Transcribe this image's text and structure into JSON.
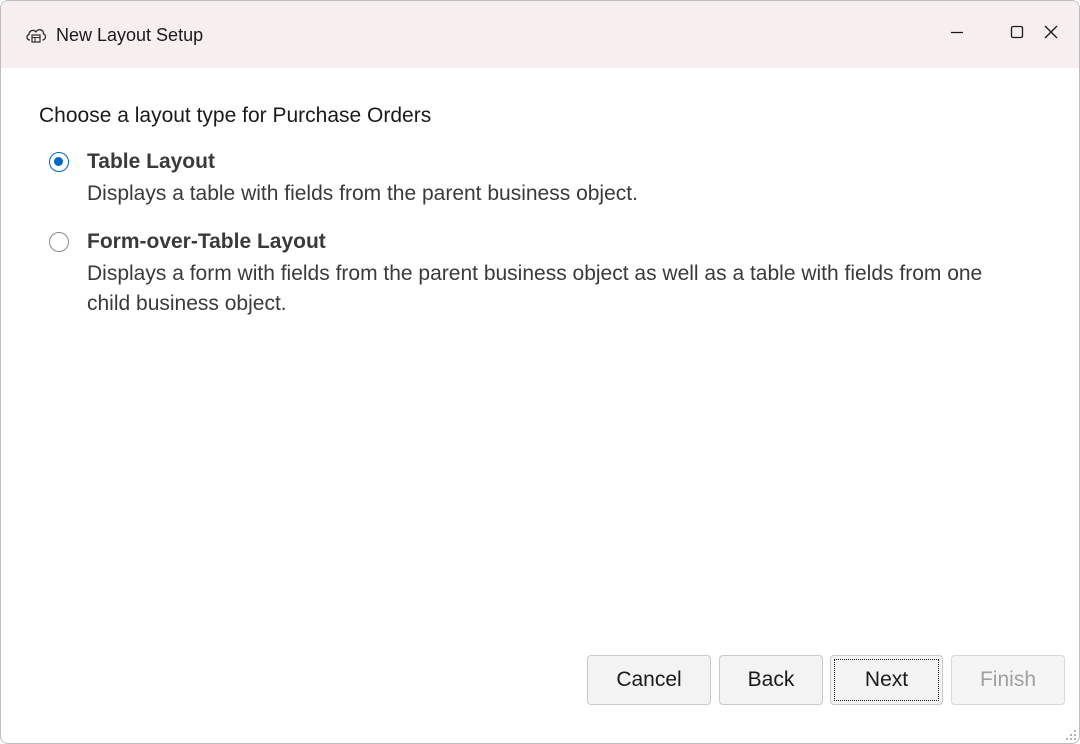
{
  "window": {
    "title": "New Layout Setup",
    "icon": "cloud-layout-icon",
    "controls": {
      "minimize_icon": "minimize-icon",
      "maximize_icon": "maximize-icon",
      "close_icon": "close-icon"
    }
  },
  "main": {
    "heading": "Choose a layout type for Purchase Orders",
    "options": [
      {
        "title": "Table Layout",
        "description": "Displays a table with fields from the parent business object.",
        "selected": true
      },
      {
        "title": "Form-over-Table Layout",
        "description": "Displays a form with fields from the parent business object as well as a table with fields from one child business object.",
        "selected": false
      }
    ]
  },
  "footer": {
    "cancel_label": "Cancel",
    "back_label": "Back",
    "next_label": "Next",
    "finish_label": "Finish",
    "finish_disabled": true
  },
  "colors": {
    "titlebar": "#f7efef",
    "accent": "#0067c0"
  }
}
